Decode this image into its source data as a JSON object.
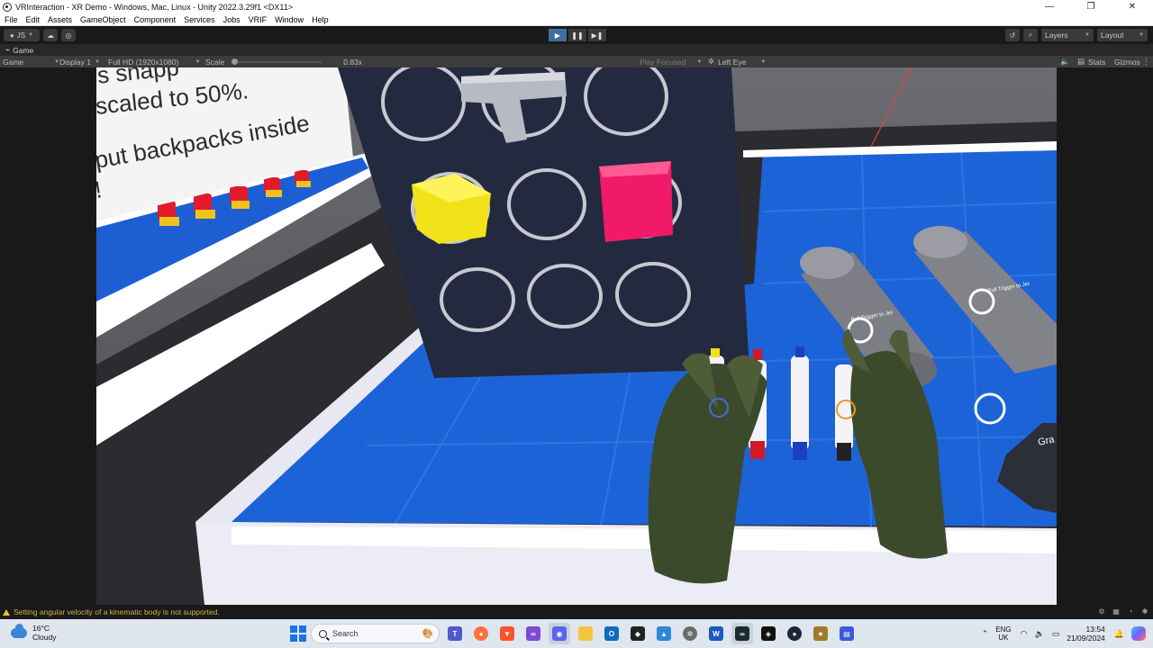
{
  "window": {
    "title": "VRInteraction - XR Demo - Windows, Mac, Linux - Unity 2022.3.29f1 <DX11>",
    "minimize": "—",
    "maximize": "❐",
    "close": "✕"
  },
  "menu": [
    "File",
    "Edit",
    "Assets",
    "GameObject",
    "Component",
    "Services",
    "Jobs",
    "VRIF",
    "Window",
    "Help"
  ],
  "toolbar": {
    "account_label": "JS",
    "layers_label": "Layers",
    "layout_label": "Layout"
  },
  "game_tab": {
    "label": "Game"
  },
  "game_bar": {
    "view_mode": "Game",
    "display": "Display 1",
    "resolution": "Full HD (1920x1080)",
    "scale_label": "Scale",
    "scale_value": "0.83x",
    "play_focused": "Play Focused",
    "eye": "Left Eye",
    "stats": "Stats",
    "gizmos": "Gizmos"
  },
  "scene": {
    "sign_line1": "s snapp",
    "sign_line2": "scaled to 50%.",
    "sign_line3": "put backpacks inside",
    "sign_line4": "!",
    "cyl_label1": "Pull Trigger to Jet",
    "cyl_label2": "Pull Trigger to Jet",
    "grab_label": "Gra"
  },
  "status": {
    "message": "Setting angular velocity of a kinematic body is not supported."
  },
  "taskbar": {
    "temp": "16°C",
    "condition": "Cloudy",
    "search_placeholder": "Search",
    "lang_line1": "ENG",
    "lang_line2": "UK",
    "time": "13:54",
    "date": "21/09/2024"
  }
}
